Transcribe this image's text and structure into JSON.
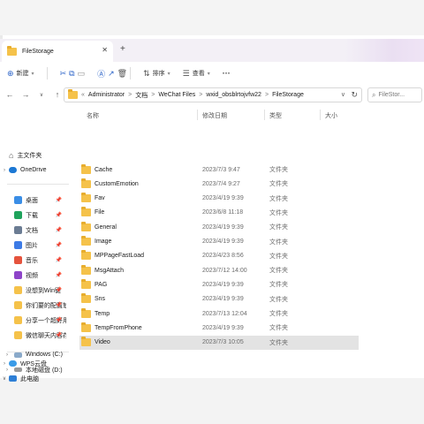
{
  "tab": {
    "title": "FileStorage",
    "close": "✕",
    "new_tab": "+"
  },
  "toolbar": {
    "new_label": "新建",
    "sort_label": "排序",
    "view_label": "查看",
    "more": "···"
  },
  "address": {
    "crumbs": [
      "Administrator",
      "文档",
      "WeChat Files",
      "wxid_obsblrtojvfw22",
      "FileStorage"
    ],
    "search_placeholder": "FileStor..."
  },
  "sidebar": {
    "top": [
      {
        "label": "主文件夹",
        "icon": "home-icon"
      },
      {
        "label": "OneDrive",
        "icon": "cloud-icon"
      }
    ],
    "quick": [
      {
        "label": "桌面",
        "icon": "desktop-icon",
        "color": "#3a8ee6"
      },
      {
        "label": "下载",
        "icon": "download-icon",
        "color": "#1fa35c"
      },
      {
        "label": "文档",
        "icon": "document-icon",
        "color": "#6b7c93"
      },
      {
        "label": "图片",
        "icon": "picture-icon",
        "color": "#3d7be6"
      },
      {
        "label": "音乐",
        "icon": "music-icon",
        "color": "#e5533d"
      },
      {
        "label": "视频",
        "icon": "video-icon",
        "color": "#8e44c9"
      },
      {
        "label": "没想到Win键",
        "icon": "folder-icon",
        "color": "#f5c24a"
      },
      {
        "label": "你们要的配置软",
        "icon": "folder-icon",
        "color": "#f5c24a"
      },
      {
        "label": "分享一个超好用",
        "icon": "folder-icon",
        "color": "#f5c24a"
      },
      {
        "label": "微信聊天内容存",
        "icon": "folder-icon",
        "color": "#f5c24a"
      }
    ],
    "bottom": [
      {
        "label": "WPS云盘",
        "icon": "wps-cloud-icon"
      },
      {
        "label": "此电脑",
        "icon": "computer-icon"
      },
      {
        "label": "Windows (C:)",
        "icon": "drive-icon"
      },
      {
        "label": "本地磁盘 (D:)",
        "icon": "drive-icon"
      }
    ]
  },
  "columns": {
    "name": "名称",
    "date": "修改日期",
    "type": "类型",
    "size": "大小"
  },
  "files": [
    {
      "name": "Cache",
      "date": "2023/7/3 9:47",
      "type": "文件夹"
    },
    {
      "name": "CustomEmotion",
      "date": "2023/7/4 9:27",
      "type": "文件夹"
    },
    {
      "name": "Fav",
      "date": "2023/4/19 9:39",
      "type": "文件夹"
    },
    {
      "name": "File",
      "date": "2023/6/8 11:18",
      "type": "文件夹"
    },
    {
      "name": "General",
      "date": "2023/4/19 9:39",
      "type": "文件夹"
    },
    {
      "name": "Image",
      "date": "2023/4/19 9:39",
      "type": "文件夹"
    },
    {
      "name": "MPPageFastLoad",
      "date": "2023/4/23 8:56",
      "type": "文件夹"
    },
    {
      "name": "MsgAttach",
      "date": "2023/7/12 14:00",
      "type": "文件夹"
    },
    {
      "name": "PAG",
      "date": "2023/4/19 9:39",
      "type": "文件夹"
    },
    {
      "name": "Sns",
      "date": "2023/4/19 9:39",
      "type": "文件夹"
    },
    {
      "name": "Temp",
      "date": "2023/7/13 12:04",
      "type": "文件夹"
    },
    {
      "name": "TempFromPhone",
      "date": "2023/4/19 9:39",
      "type": "文件夹"
    },
    {
      "name": "Video",
      "date": "2023/7/3 10:05",
      "type": "文件夹",
      "selected": true
    }
  ]
}
